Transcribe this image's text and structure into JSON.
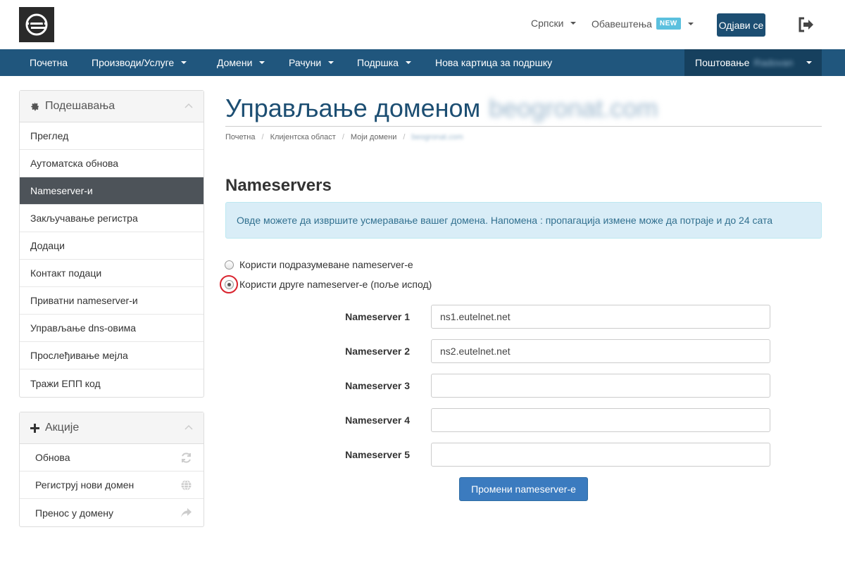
{
  "header": {
    "language": "Српски",
    "notifications": "Обавештења",
    "notifications_badge": "NEW",
    "logout": "Одјави се"
  },
  "nav": {
    "items": [
      "Почетна",
      "Производи/Услуге",
      "Домени",
      "Рачуни",
      "Подршка",
      "Нова картица за подршку"
    ],
    "greeting": "Поштовање",
    "user_name": "Radovan"
  },
  "sidebar": {
    "settings_title": "Подешавања",
    "settings_items": [
      "Преглед",
      "Аутоматска обнова",
      "Nameserver-и",
      "Закључавање регистра",
      "Додаци",
      "Контакт подаци",
      "Приватни nameserver-и",
      "Управљање dns-овима",
      "Прослеђивање мејла",
      "Тражи ЕПП код"
    ],
    "actions_title": "Акције",
    "actions_items": [
      "Обнова",
      "Региструј нови домен",
      "Пренос у домену"
    ]
  },
  "main": {
    "title": "Управљање доменом",
    "domain": "beogronat.com",
    "breadcrumb": [
      "Почетна",
      "Клијентска област",
      "Моји домени",
      "beogronat.com"
    ],
    "section_title": "Nameservers",
    "info": "Овде можете да извршите усмеравање вашег домена. Напомена : пропагација измене може да потраје и до 24 сата",
    "radio_default": "Користи подразумеване nameserver-е",
    "radio_custom": "Користи друге nameserver-е (поље испод)",
    "nameservers": [
      {
        "label": "Nameserver 1",
        "value": "ns1.eutelnet.net"
      },
      {
        "label": "Nameserver 2",
        "value": "ns2.eutelnet.net"
      },
      {
        "label": "Nameserver 3",
        "value": ""
      },
      {
        "label": "Nameserver 4",
        "value": ""
      },
      {
        "label": "Nameserver 5",
        "value": ""
      }
    ],
    "submit": "Промени nameserver-е"
  },
  "colors": {
    "brand": "#20567d",
    "title": "#1c4e72",
    "active_item": "#4d5359",
    "button": "#3b7bbf",
    "highlight": "#d9232e"
  }
}
